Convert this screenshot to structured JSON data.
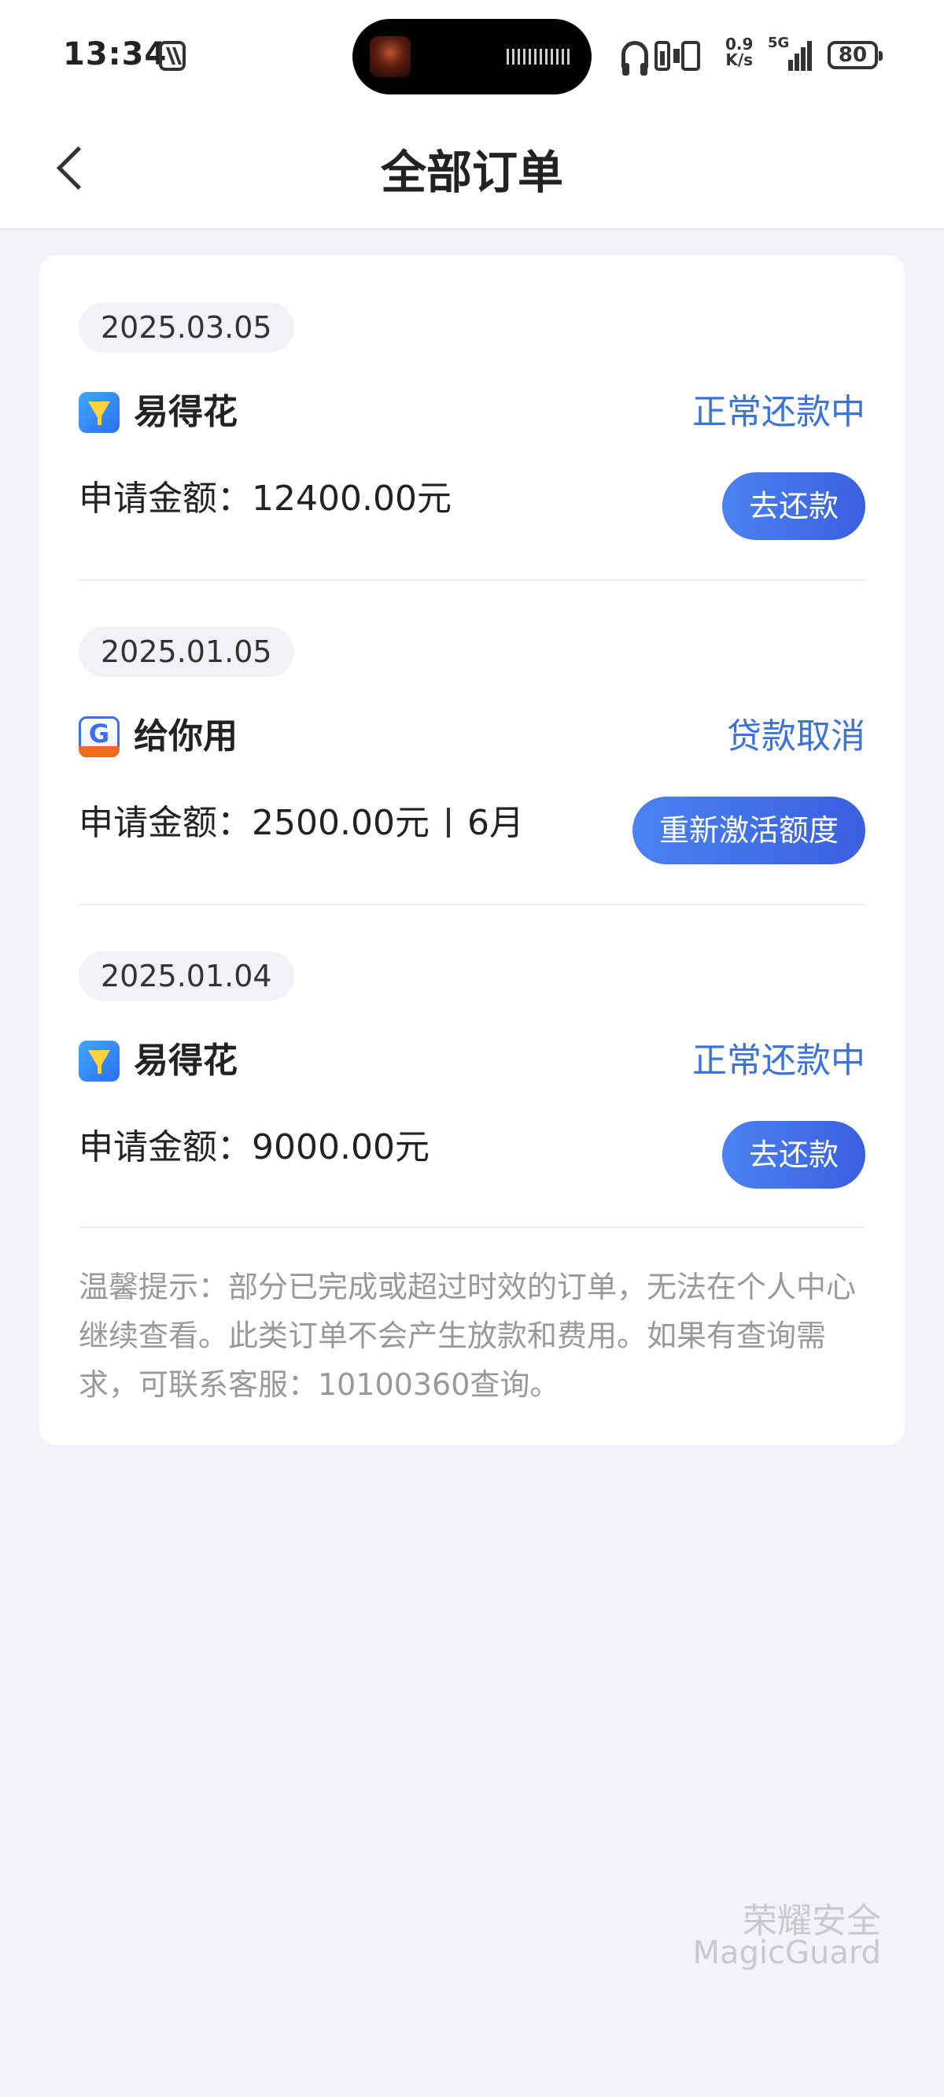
{
  "status_bar": {
    "time": "13:34",
    "net_speed_top": "0.9",
    "net_speed_bottom": "K/s",
    "signal_label": "5G",
    "battery": "80"
  },
  "nav": {
    "title": "全部订单"
  },
  "orders": [
    {
      "date": "2025.03.05",
      "app": "易得花",
      "status": "正常还款中",
      "amount_label": "申请金额：12400.00元",
      "term": "",
      "button": "去还款"
    },
    {
      "date": "2025.01.05",
      "app": "给你用",
      "status": "贷款取消",
      "amount_label": "申请金额：2500.00元",
      "term": "6月",
      "button": "重新激活额度"
    },
    {
      "date": "2025.01.04",
      "app": "易得花",
      "status": "正常还款中",
      "amount_label": "申请金额：9000.00元",
      "term": "",
      "button": "去还款"
    }
  ],
  "tip": "温馨提示：部分已完成或超过时效的订单，无法在个人中心继续查看。此类订单不会产生放款和费用。如果有查询需求，可联系客服：10100360查询。",
  "watermark": {
    "cn": "荣耀安全",
    "en": "MagicGuard"
  }
}
